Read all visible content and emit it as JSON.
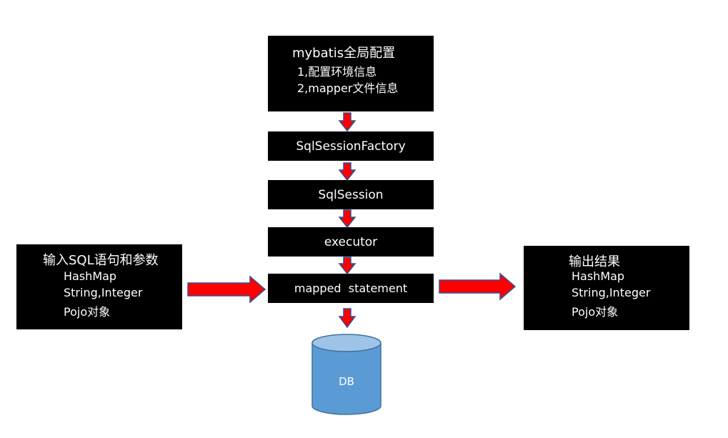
{
  "config_box": {
    "title": "mybatis全局配置",
    "items": [
      "1,配置环境信息",
      "2,mapper文件信息"
    ]
  },
  "factory_box": {
    "label": "SqlSessionFactory"
  },
  "session_box": {
    "label": "SqlSession"
  },
  "executor_box": {
    "label": "executor"
  },
  "mapped_box": {
    "label": "mapped  statement"
  },
  "input_box": {
    "title": "输入SQL语句和参数",
    "items": [
      "HashMap",
      "String,Integer",
      "Pojo对象"
    ]
  },
  "output_box": {
    "title": "输出结果",
    "items": [
      "HashMap",
      "String,Integer",
      "Pojo对象"
    ]
  },
  "db": {
    "label": "DB"
  },
  "colors": {
    "box_bg": "#000000",
    "box_text": "#ffffff",
    "arrow_fill": "#ff0000",
    "arrow_stroke": "#2f5597",
    "db_fill": "#5b9bd5",
    "db_top": "#9dc3e6",
    "db_stroke": "#41719c"
  }
}
